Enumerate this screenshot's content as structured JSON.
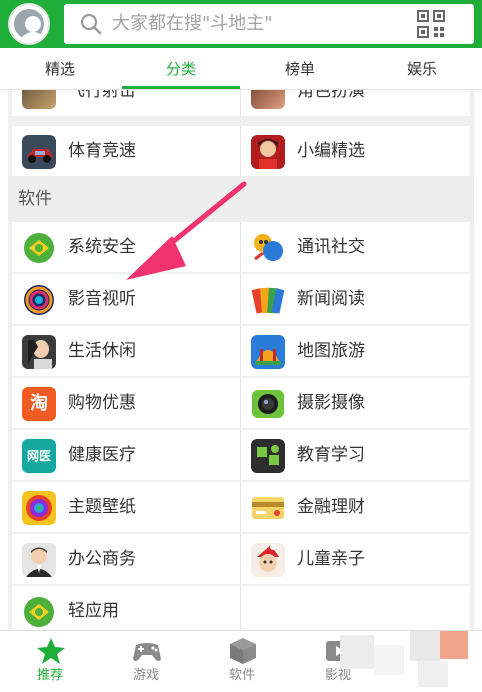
{
  "search": {
    "placeholder": "大家都在搜\"斗地主\""
  },
  "tabs": [
    {
      "label": "精选",
      "active": false
    },
    {
      "label": "分类",
      "active": true
    },
    {
      "label": "榜单",
      "active": false
    },
    {
      "label": "娱乐",
      "active": false
    }
  ],
  "games_partial": {
    "cut_row": {
      "left": "飞行射击",
      "right": "角色扮演"
    },
    "row": {
      "left": "体育竞速",
      "right": "小编精选"
    }
  },
  "software": {
    "title": "软件",
    "rows": [
      {
        "left": {
          "label": "系统安全",
          "icon": "shield-icon"
        },
        "right": {
          "label": "通讯社交",
          "icon": "chat-icon"
        }
      },
      {
        "left": {
          "label": "影音视听",
          "icon": "media-icon"
        },
        "right": {
          "label": "新闻阅读",
          "icon": "book-icon"
        }
      },
      {
        "left": {
          "label": "生活休闲",
          "icon": "lifestyle-icon"
        },
        "right": {
          "label": "地图旅游",
          "icon": "map-icon"
        }
      },
      {
        "left": {
          "label": "购物优惠",
          "icon": "shopping-icon"
        },
        "right": {
          "label": "摄影摄像",
          "icon": "camera-icon"
        }
      },
      {
        "left": {
          "label": "健康医疗",
          "icon": "health-icon"
        },
        "right": {
          "label": "教育学习",
          "icon": "education-icon"
        }
      },
      {
        "left": {
          "label": "主题壁纸",
          "icon": "wallpaper-icon"
        },
        "right": {
          "label": "金融理财",
          "icon": "finance-icon"
        }
      },
      {
        "left": {
          "label": "办公商务",
          "icon": "office-icon"
        },
        "right": {
          "label": "儿童亲子",
          "icon": "kids-icon"
        }
      },
      {
        "left": {
          "label": "轻应用",
          "icon": "light-app-icon"
        }
      }
    ]
  },
  "icon_text": {
    "shopping": "淘",
    "health": "网医"
  },
  "bottom_nav": [
    {
      "label": "推荐",
      "icon": "star-icon",
      "active": true
    },
    {
      "label": "游戏",
      "icon": "gamepad-icon",
      "active": false
    },
    {
      "label": "软件",
      "icon": "box-icon",
      "active": false
    },
    {
      "label": "影视",
      "icon": "film-icon",
      "active": false
    }
  ],
  "colors": {
    "brand_green": "#20ae3a",
    "arrow": "#f0326e",
    "text": "#333333",
    "muted": "#888888"
  }
}
